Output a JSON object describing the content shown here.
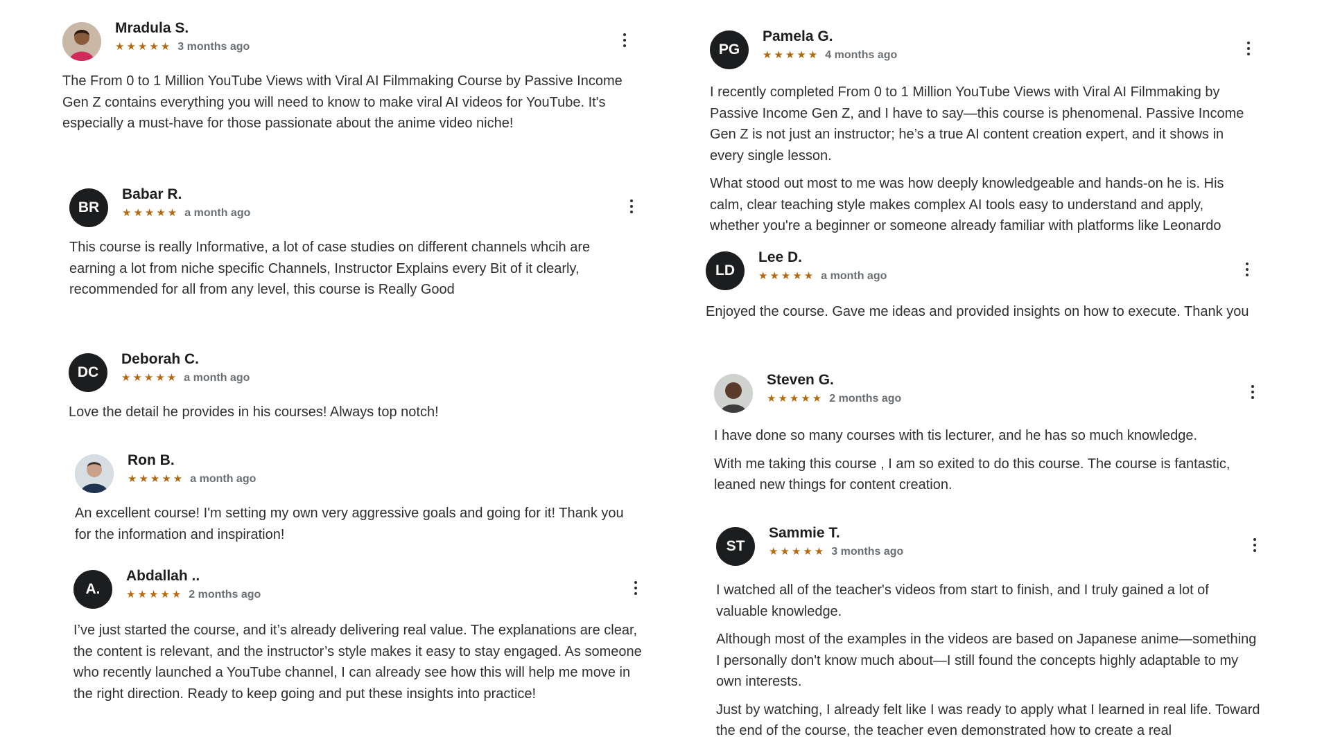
{
  "reviews_left": [
    {
      "name": "Mradula S.",
      "initials": "",
      "stars": "★★★★★",
      "rating": 5,
      "time": "3 months ago",
      "paragraphs": [
        "The From 0 to 1 Million YouTube Views with Viral AI Filmmaking Course by Passive Income Gen Z contains everything you will need to know to make viral AI videos for YouTube. It's especially a must-have for those passionate about the anime video niche!"
      ]
    },
    {
      "name": "Babar R.",
      "initials": "BR",
      "stars": "★★★★★",
      "rating": 5,
      "time": "a month ago",
      "paragraphs": [
        "This course is really Informative, a lot of case studies on different channels whcih are earning a lot from niche specific Channels, Instructor Explains every Bit of it clearly, recommended for all from any level, this course is Really Good"
      ]
    },
    {
      "name": "Deborah C.",
      "initials": "DC",
      "stars": "★★★★★",
      "rating": 5,
      "time": "a month ago",
      "paragraphs": [
        "Love the detail he provides in his courses! Always top notch!"
      ]
    },
    {
      "name": "Ron B.",
      "initials": "",
      "stars": "★★★★★",
      "rating": 5,
      "time": "a month ago",
      "paragraphs": [
        "An excellent course! I'm setting my own very aggressive goals and going for it! Thank you for the information and inspiration!"
      ]
    },
    {
      "name": "Abdallah ..",
      "initials": "A.",
      "stars": "★★★★★",
      "rating": 5,
      "time": "2 months ago",
      "paragraphs": [
        "I’ve just started the course, and it’s already delivering real value. The explanations are clear, the content is relevant, and the instructor’s style makes it easy to stay engaged. As someone who recently launched a YouTube channel, I can already see how this will help me move in the right direction. Ready to keep going and put these insights into practice!"
      ]
    }
  ],
  "reviews_right": [
    {
      "name": "Pamela G.",
      "initials": "PG",
      "stars": "★★★★★",
      "rating": 5,
      "time": "4 months ago",
      "paragraphs": [
        "I recently completed From 0 to 1 Million YouTube Views with Viral AI Filmmaking by Passive Income Gen Z, and I have to say—this course is phenomenal. Passive Income Gen Z is not just an instructor; he’s a true AI content creation expert, and it shows in every single lesson.",
        "What stood out most to me was how deeply knowledgeable and hands-on he is. His calm, clear teaching style makes complex AI tools easy to understand and apply, whether you're a beginner or someone already familiar with platforms like Leonardo"
      ]
    },
    {
      "name": "Lee D.",
      "initials": "LD",
      "stars": "★★★★★",
      "rating": 5,
      "time": "a month ago",
      "paragraphs": [
        "Enjoyed the course. Gave me ideas and provided insights on how to execute. Thank you"
      ]
    },
    {
      "name": "Steven G.",
      "initials": "",
      "stars": "★★★★★",
      "rating": 5,
      "time": "2 months ago",
      "paragraphs": [
        "I have done so many courses with tis lecturer, and he has so much knowledge.",
        "With me taking this course , I am so exited to do this course. The course is fantastic, leaned new things for content creation."
      ]
    },
    {
      "name": "Sammie T.",
      "initials": "ST",
      "stars": "★★★★★",
      "rating": 5,
      "time": "3 months ago",
      "paragraphs": [
        "I watched all of the teacher's videos from start to finish, and I truly gained a lot of valuable knowledge.",
        "Although most of the examples in the videos are based on Japanese anime—something I personally don't know much about—I still found the concepts highly adaptable to my own interests.",
        "Just by watching, I already felt like I was ready to apply what I learned in real life. Toward the end of the course, the teacher even demonstrated how to create a real"
      ]
    }
  ],
  "icons": {
    "menu": "more-vertical-icon",
    "star": "star-icon"
  },
  "colors": {
    "star": "#b4690e",
    "avatar_bg": "#1c1d1f",
    "meta_text": "#6a6f73",
    "body_text": "#2d2f31"
  }
}
